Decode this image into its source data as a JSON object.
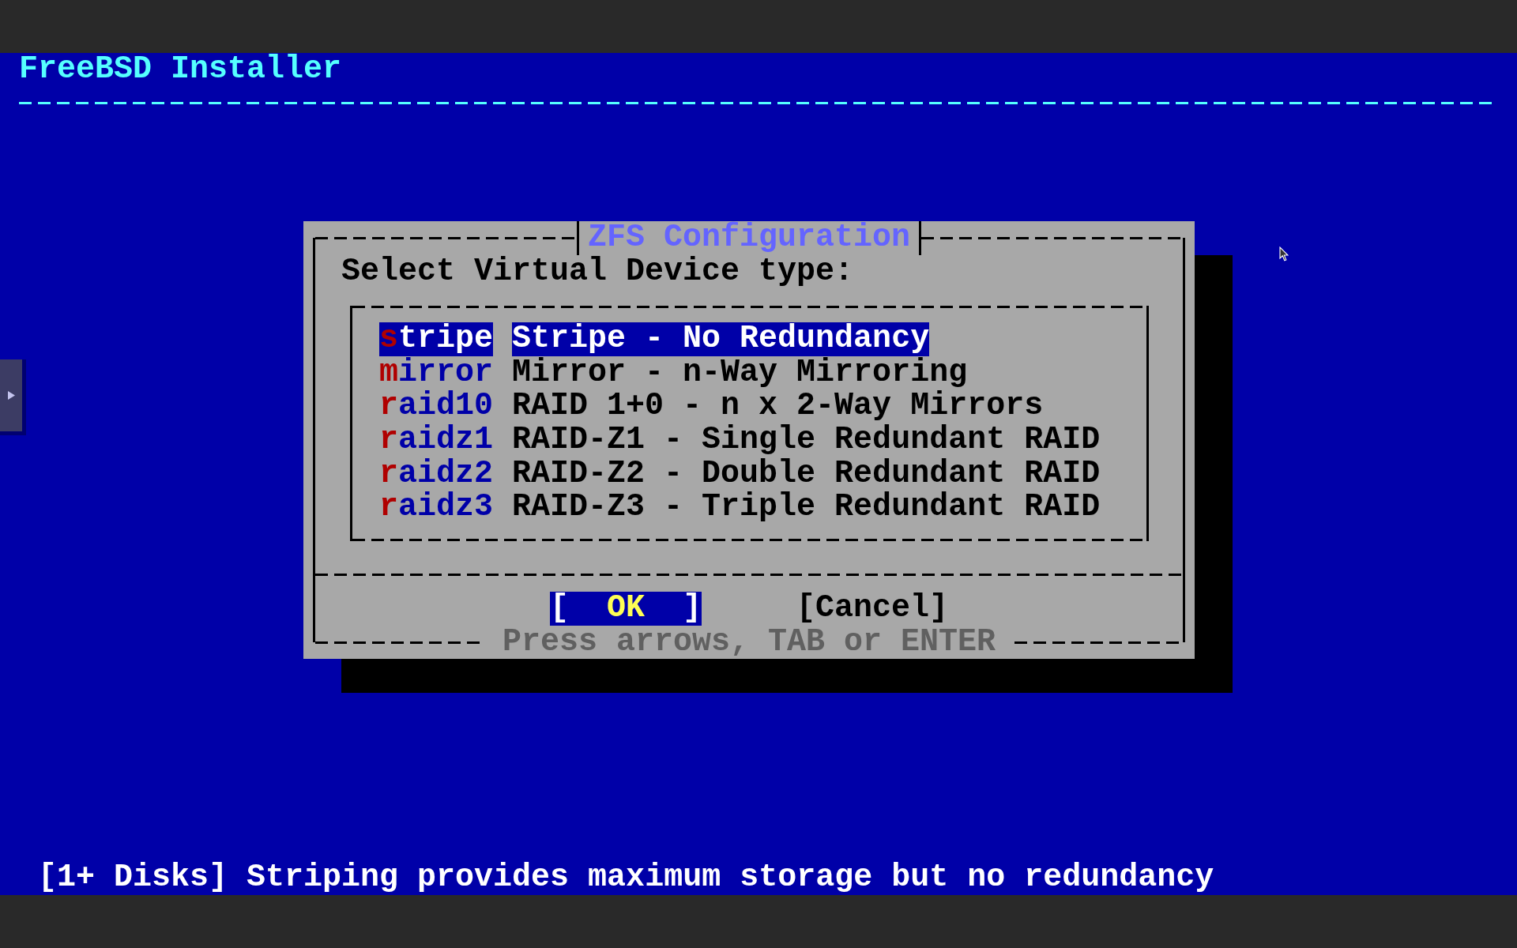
{
  "screen": {
    "backtitle": "FreeBSD Installer"
  },
  "dialog": {
    "title": "ZFS Configuration",
    "prompt": "Select Virtual Device type:",
    "options": [
      {
        "name": "stripe",
        "description": "Stripe - No Redundancy",
        "selected": true
      },
      {
        "name": "mirror",
        "description": "Mirror - n-Way Mirroring",
        "selected": false
      },
      {
        "name": "raid10",
        "description": "RAID 1+0 - n x 2-Way Mirrors",
        "selected": false
      },
      {
        "name": "raidz1",
        "description": "RAID-Z1 - Single Redundant RAID",
        "selected": false
      },
      {
        "name": "raidz2",
        "description": "RAID-Z2 - Double Redundant RAID",
        "selected": false
      },
      {
        "name": "raidz3",
        "description": "RAID-Z3 - Triple Redundant RAID",
        "selected": false
      }
    ],
    "buttons": [
      {
        "label": "[  OK  ]",
        "selected": true
      },
      {
        "label": "[Cancel]",
        "selected": false
      }
    ],
    "hint": "Press arrows, TAB or ENTER"
  },
  "status_bar": {
    "text": "[1+ Disks] Striping provides maximum storage but no redundancy"
  }
}
